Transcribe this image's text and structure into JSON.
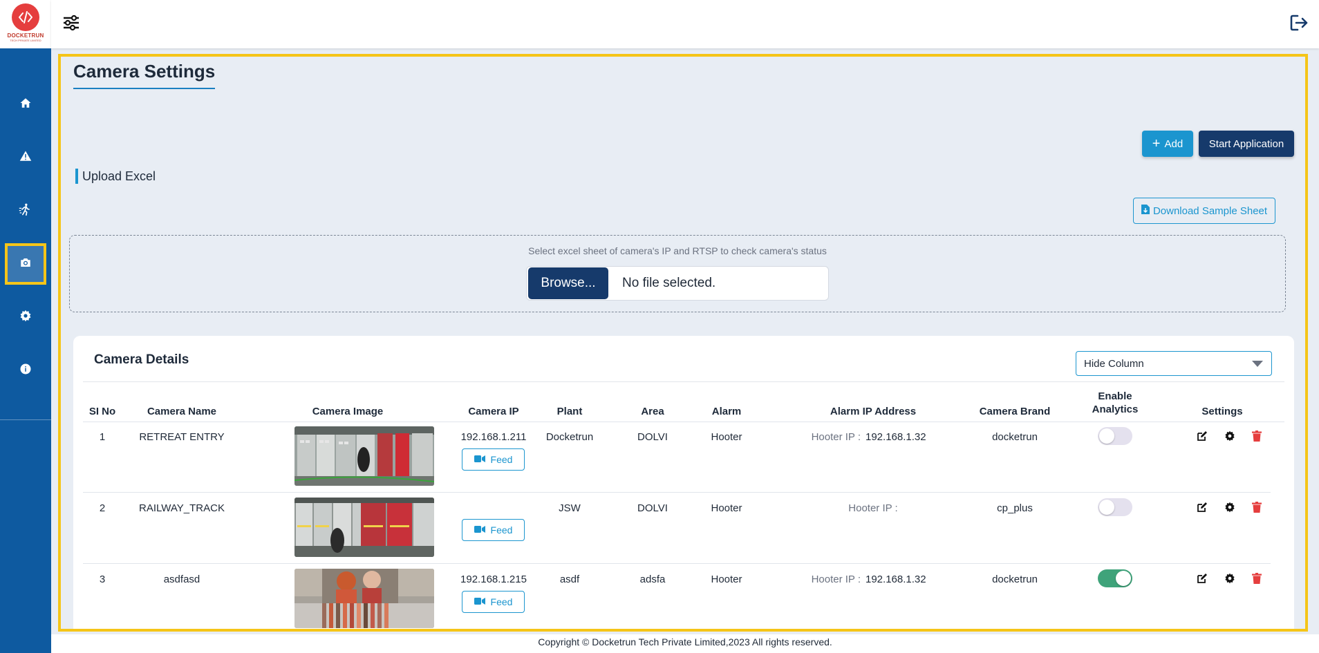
{
  "brand": {
    "name": "DOCKETRUN",
    "tagline": "TECH PRIVATE LIMITED"
  },
  "sidebar": {
    "items": [
      {
        "icon": "home-icon",
        "active": false
      },
      {
        "icon": "warning-icon",
        "active": false
      },
      {
        "icon": "running-person-icon",
        "active": false
      },
      {
        "icon": "camera-icon",
        "active": true
      },
      {
        "icon": "gear-icon",
        "active": false
      },
      {
        "icon": "info-icon",
        "active": false
      }
    ]
  },
  "page": {
    "title": "Camera Settings"
  },
  "toolbar": {
    "add_label": "Add",
    "start_label": "Start Application"
  },
  "upload": {
    "heading": "Upload Excel",
    "download_label": "Download Sample Sheet",
    "hint": "Select excel sheet of camera's IP and RTSP to check camera's status",
    "browse_label": "Browse...",
    "file_status": "No file selected."
  },
  "camera_details": {
    "title": "Camera Details",
    "hide_column_value": "Hide Column",
    "columns": [
      "SI No",
      "Camera Name",
      "Camera Image",
      "Camera IP",
      "Plant",
      "Area",
      "Alarm",
      "Alarm IP Address",
      "Camera Brand",
      "Enable Analytics",
      "Settings"
    ],
    "feed_label": "Feed",
    "rows": [
      {
        "si": "1",
        "name": "RETREAT ENTRY",
        "ip": "192.168.1.211",
        "plant": "Docketrun",
        "area": "DOLVI",
        "alarm": "Hooter",
        "alarm_ip_label": "Hooter IP :",
        "alarm_ip": "192.168.1.32",
        "brand": "docketrun",
        "analytics": false,
        "has_feed": true
      },
      {
        "si": "2",
        "name": "RAILWAY_TRACK",
        "ip": "",
        "plant": "JSW",
        "area": "DOLVI",
        "alarm": "Hooter",
        "alarm_ip_label": "Hooter IP :",
        "alarm_ip": "",
        "brand": "cp_plus",
        "analytics": false,
        "has_feed": true
      },
      {
        "si": "3",
        "name": "asdfasd",
        "ip": "192.168.1.215",
        "plant": "asdf",
        "area": "adsfa",
        "alarm": "Hooter",
        "alarm_ip_label": "Hooter IP :",
        "alarm_ip": "192.168.1.32",
        "brand": "docketrun",
        "analytics": true,
        "has_feed": true
      }
    ]
  },
  "footer": {
    "text": "Copyright © Docketrun Tech Private Limited,2023 All rights reserved."
  },
  "colors": {
    "sidebar": "#0e5aa0",
    "accent": "#1b95cf",
    "navy": "#163a6b",
    "highlight": "#f5c518",
    "danger": "#e53e3e",
    "toggle_on": "#3fa37a"
  }
}
